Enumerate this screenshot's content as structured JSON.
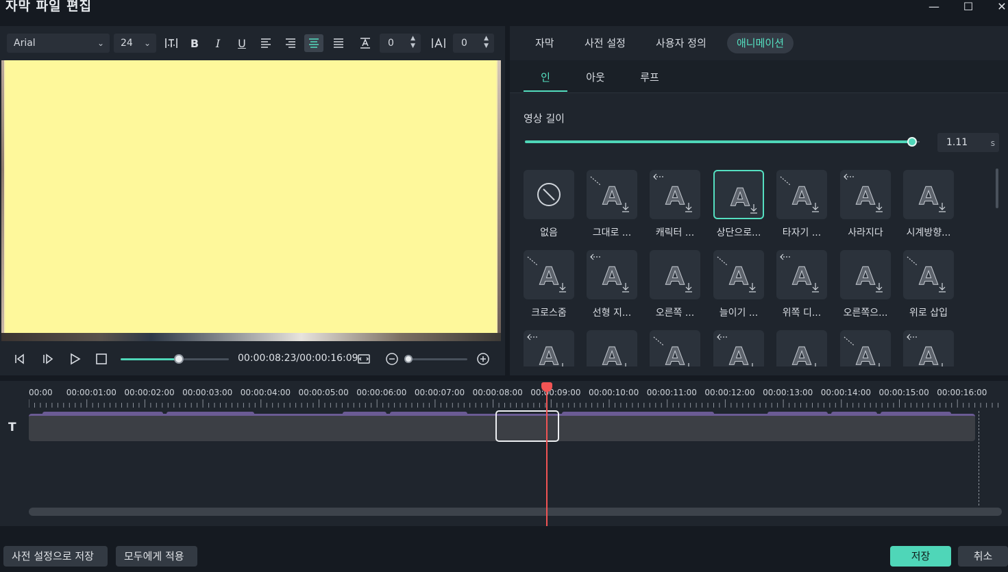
{
  "window": {
    "title": "자막 파일 편집",
    "minimize": "—",
    "maximize": "☐",
    "close": "✕"
  },
  "toolbar": {
    "font": "Arial",
    "size": "24",
    "spacing1_value": "0",
    "spacing2_value": "0",
    "chevron": "⌄"
  },
  "player": {
    "timecode": "00:00:08:23/00:00:16:09",
    "progress": 0.54
  },
  "right": {
    "tabs": [
      "자막",
      "사전 설정",
      "사용자 정의",
      "애니메이션"
    ],
    "subtabs": [
      "인",
      "아웃",
      "루프"
    ],
    "duration_label": "영상 길이",
    "duration_value": "1.11",
    "duration_unit": "s",
    "animations": [
      "없음",
      "그대로 ...",
      "캐릭터 ...",
      "상단으로...",
      "타자기 ...",
      "사라지다",
      "시계방향...",
      "크로스줌",
      "선형 지...",
      "오른쪽 ...",
      "늘이기 ...",
      "위쪽 디...",
      "오른쪽으...",
      "위로 삽입"
    ]
  },
  "timeline": {
    "labels": [
      "00:00",
      "00:00:01:00",
      "00:00:02:00",
      "00:00:03:00",
      "00:00:04:00",
      "00:00:05:00",
      "00:00:06:00",
      "00:00:07:00",
      "00:00:08:00",
      "00:00:09:00",
      "00:00:10:00",
      "00:00:11:00",
      "00:00:12:00",
      "00:00:13:00",
      "00:00:14:00",
      "00:00:15:00",
      "00:00:16:00"
    ],
    "track_icon": "T"
  },
  "bottom": {
    "save_preset": "사전 설정으로 저장",
    "apply_all": "모두에게 적용",
    "save": "저장",
    "cancel": "취소"
  },
  "colors": {
    "accent": "#4fd6b8",
    "playhead": "#f25454",
    "clip": "#6b5b94",
    "paper": "#fef89b"
  }
}
